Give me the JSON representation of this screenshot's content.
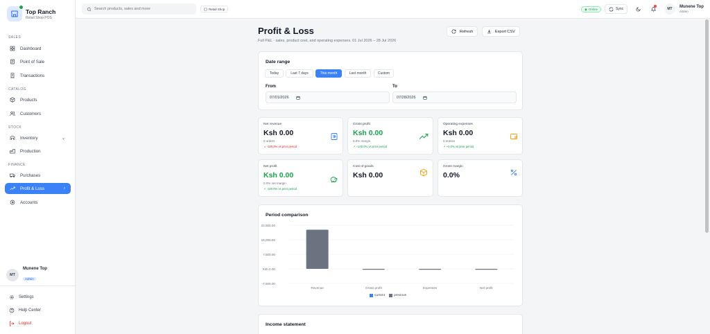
{
  "brand": {
    "name": "Top Ranch",
    "subtitle": "Retail Shop POS",
    "online_color": "#16a34a"
  },
  "sidebar": {
    "sections": [
      {
        "label": "SALES",
        "items": [
          {
            "label": "Dashboard",
            "icon": "dashboard-icon"
          },
          {
            "label": "Point of Sale",
            "icon": "pos-icon"
          },
          {
            "label": "Transactions",
            "icon": "transactions-icon"
          }
        ]
      },
      {
        "label": "CATALOG",
        "items": [
          {
            "label": "Products",
            "icon": "box-icon"
          },
          {
            "label": "Customers",
            "icon": "users-icon"
          }
        ]
      },
      {
        "label": "STOCK",
        "items": [
          {
            "label": "Inventory",
            "icon": "inventory-icon"
          },
          {
            "label": "Production",
            "icon": "factory-icon"
          }
        ]
      },
      {
        "label": "FINANCE",
        "items": [
          {
            "label": "Purchases",
            "icon": "truck-icon"
          },
          {
            "label": "Profit & Loss",
            "icon": "trend-up-icon",
            "active": true
          },
          {
            "label": "Accounts",
            "icon": "accounts-icon"
          }
        ]
      }
    ],
    "user": {
      "initials": "MT",
      "name": "Munene Top",
      "role": "Admin"
    },
    "bottom": {
      "settings": "Settings",
      "help": "Help Center",
      "logout": "Logout"
    }
  },
  "topbar": {
    "search_placeholder": "Search products, sales and more",
    "store_chip": "Retail Shop",
    "online": "Online",
    "sync": "Sync",
    "user": {
      "initials": "MT",
      "name": "Munene Top",
      "role": "Admin"
    }
  },
  "page": {
    "title": "Profit & Loss",
    "subtitle": "Full P&L · sales, product cost, and operating expenses. 01 Jul 2026 – 28 Jul 2026",
    "refresh": "Refresh",
    "export": "Export CSV"
  },
  "date_range": {
    "title": "Date range",
    "options": [
      "Today",
      "Last 7 days",
      "This month",
      "Last month",
      "Custom"
    ],
    "active": "This month",
    "from_label": "From",
    "from_value": "07/01/2026",
    "to_label": "To",
    "to_value": "07/28/2026"
  },
  "stats": [
    {
      "label": "Net revenue",
      "value": "Ksh 0.00",
      "sub": "0 orders",
      "delta": "-100.0% vs prior period",
      "delta_type": "red",
      "icon": "receipt-icon",
      "icon_color": "#3b82f6"
    },
    {
      "label": "Gross profit",
      "value": "Ksh 0.00",
      "sub": "0.0% margin",
      "delta": "+100.0% vs prior period",
      "delta_type": "green",
      "value_green": true,
      "icon": "trend-up-icon",
      "icon_color": "#16a34a"
    },
    {
      "label": "Operating expenses",
      "value": "Ksh 0.00",
      "sub": "0 entries",
      "delta": "+0.0% vs prior period",
      "delta_type": "green",
      "icon": "wallet-icon",
      "icon_color": "#f59e0b"
    },
    {
      "label": "Net profit",
      "value": "Ksh 0.00",
      "sub": "0.0% net margin",
      "delta": "-100.0% vs prior period",
      "delta_type": "green",
      "value_green": true,
      "icon": "piggy-bank-icon",
      "icon_color": "#16a34a"
    },
    {
      "label": "Cost of goods",
      "value": "Ksh 0.00",
      "sub": "",
      "delta": "",
      "icon": "box-icon",
      "icon_color": "#f59e0b"
    },
    {
      "label": "Gross margin",
      "value": "0.0%",
      "sub": "",
      "delta": "",
      "icon": "percent-icon",
      "icon_color": "#3b82f6"
    }
  ],
  "chart_card": {
    "title": "Period comparison"
  },
  "chart_data": {
    "type": "bar",
    "categories": [
      "Revenue",
      "Gross profit",
      "Expenses",
      "Net profit"
    ],
    "series": [
      {
        "name": "current",
        "values": [
          0,
          0,
          0,
          0
        ],
        "color": "#3b82f6"
      },
      {
        "name": "previous",
        "values": [
          20200,
          0,
          0,
          0
        ],
        "color": "#6b7280"
      }
    ],
    "ytick_labels": [
      "22,500.00",
      "15,000.00",
      "7,500.00",
      "Ksh 0.00",
      "-7,500.00"
    ],
    "ylim": [
      -7500,
      22500
    ],
    "grid": true,
    "legend": "bottom"
  },
  "income_card": {
    "title": "Income statement"
  }
}
